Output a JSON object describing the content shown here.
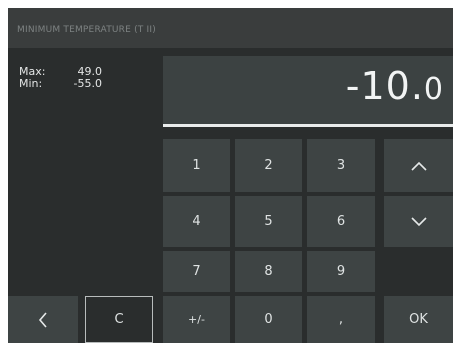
{
  "header": {
    "title": "MINIMUM TEMPERATURE (T II)"
  },
  "limits": {
    "max_label": "Max:",
    "max_value": "49.0",
    "min_label": "Min:",
    "min_value": "-55.0"
  },
  "display": {
    "value_main": "-10.",
    "value_tail": "0"
  },
  "keypad": {
    "k1": "1",
    "k2": "2",
    "k3": "3",
    "k4": "4",
    "k5": "5",
    "k6": "6",
    "k7": "7",
    "k8": "8",
    "k9": "9",
    "k0": "0",
    "sign": "+/-",
    "comma": ",",
    "clear": "C",
    "ok": "OK"
  },
  "icons": {
    "up": "chevron-up-icon",
    "down": "chevron-down-icon",
    "back": "chevron-left-icon"
  }
}
